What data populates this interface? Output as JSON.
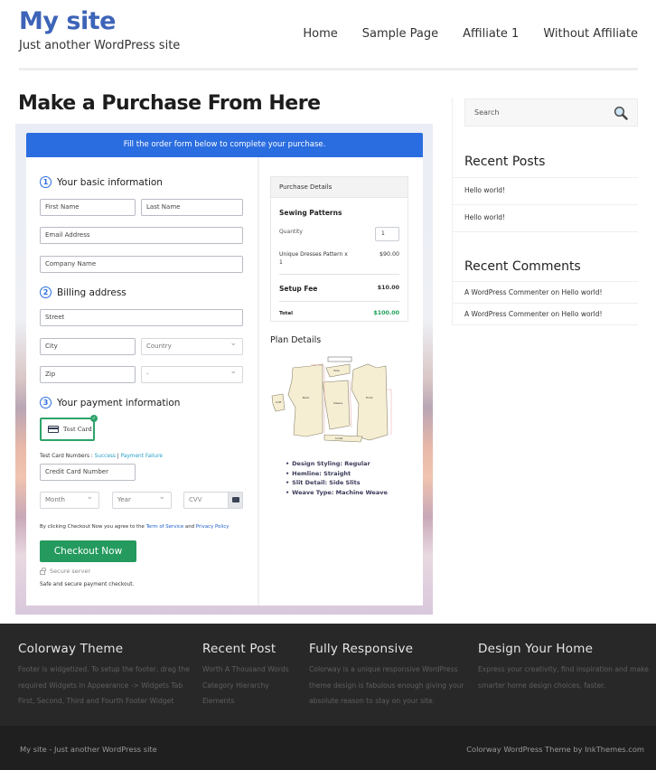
{
  "header": {
    "site_title": "My site",
    "tagline": "Just another WordPress site",
    "nav": [
      "Home",
      "Sample Page",
      "Affiliate 1",
      "Without Affiliate"
    ]
  },
  "page": {
    "title": "Make a Purchase From Here"
  },
  "checkout": {
    "banner": "Fill the order form below to complete your purchase.",
    "steps": [
      {
        "num": "1",
        "label": "Your basic information"
      },
      {
        "num": "2",
        "label": "Billing address"
      },
      {
        "num": "3",
        "label": "Your payment information"
      }
    ],
    "fields": {
      "first_name": "First Name",
      "last_name": "Last Name",
      "email": "Email Address",
      "company": "Company Name",
      "street": "Street",
      "city": "City",
      "country": "Country",
      "zip": "Zip",
      "state": "-",
      "card_number": "Credit Card Number",
      "month": "Month",
      "year": "Year",
      "cvv": "CVV"
    },
    "payment_method": "Test Card",
    "test_cards_label": "Test Card Numbers : ",
    "test_success": "Success",
    "test_separator": " | ",
    "test_failure": "Payment Failure",
    "agree_prefix": "By clicking Checkout Now you agree to the ",
    "terms_link": "Term of Service",
    "agree_and": " and ",
    "privacy_link": "Privacy Policy",
    "checkout_button": "Checkout Now",
    "secure_server": "Secure server",
    "safe_text": "Safe and secure payment checkout."
  },
  "purchase_details": {
    "header": "Purchase Details",
    "product": "Sewing Patterns",
    "quantity_label": "Quantity",
    "quantity_value": "1",
    "line_item": "Unique Dresses Pattern x",
    "line_item_qty": "1",
    "line_price": "$90.00",
    "setup_fee_label": "Setup Fee",
    "setup_fee_value": "$10.00",
    "total_label": "Total",
    "total_value": "$100.00",
    "total_color": "#1ea05a"
  },
  "plan_details": {
    "title": "Plan Details",
    "features": [
      "Design Styling: Regular",
      "Hemline: Straight",
      "Slit Detail: Side Slits",
      "Weave Type: Machine Weave"
    ]
  },
  "sidebar": {
    "search_placeholder": "Search",
    "recent_posts_title": "Recent Posts",
    "recent_posts": [
      "Hello world!",
      "Hello world!"
    ],
    "recent_comments_title": "Recent Comments",
    "recent_comments": [
      "A WordPress Commenter on Hello world!",
      "A WordPress Commenter on Hello world!"
    ]
  },
  "footer": {
    "columns": [
      {
        "title": "Colorway Theme",
        "lines": [
          "Footer is widgetized. To setup the footer, drag the",
          "required Widgets in Appearance -> Widgets Tab",
          "First, Second, Third and Fourth Footer Widget"
        ]
      },
      {
        "title": "Recent Post",
        "lines": [
          "Worth A Thousand Words",
          "Category Hierarchy",
          "Elements"
        ]
      },
      {
        "title": "Fully Responsive",
        "lines": [
          "Colorway is a unique responsive WordPress",
          "theme design is fabulous enough giving your",
          "absolute reason to stay on your site."
        ]
      },
      {
        "title": "Design Your Home",
        "lines": [
          "Express your creativity, find inspiration and make",
          "smarter home design choices, faster."
        ]
      }
    ],
    "bottom_left": "My site - Just another WordPress site",
    "bottom_right": "Colorway WordPress Theme by InkThemes.com"
  },
  "colors": {
    "brand_blue": "#3d64b8",
    "banner_blue": "#2a6de0",
    "checkout_green": "#249a5e"
  }
}
